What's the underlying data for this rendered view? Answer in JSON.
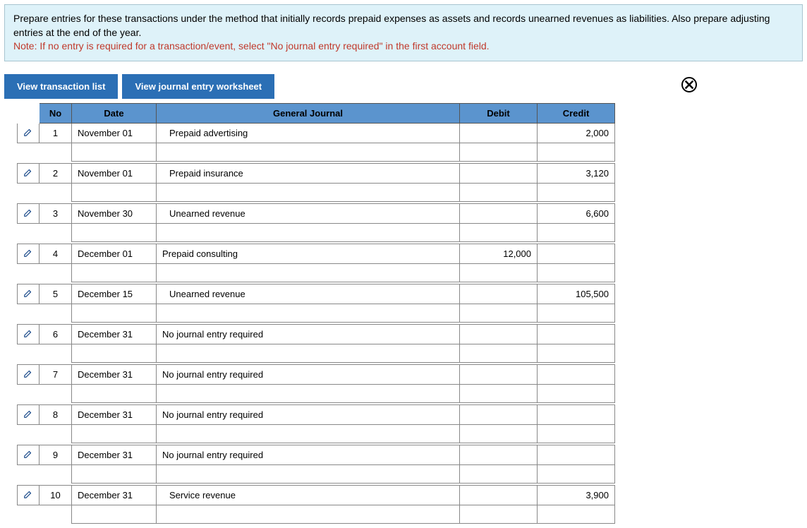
{
  "instructions": {
    "line1": "Prepare entries for these transactions under the method that initially records prepaid expenses as assets and records unearned revenues as liabilities. Also prepare adjusting entries at the end of the year.",
    "note_label": "Note:",
    "note_text": "If no entry is required for a transaction/event, select \"No journal entry required\" in the first account field."
  },
  "tabs": {
    "transaction_list": "View transaction list",
    "journal_worksheet": "View journal entry worksheet"
  },
  "headers": {
    "no": "No",
    "date": "Date",
    "gj": "General Journal",
    "debit": "Debit",
    "credit": "Credit"
  },
  "entries": [
    {
      "no": "1",
      "date": "November 01",
      "account": "Prepaid advertising",
      "indent": 1,
      "debit": "",
      "credit": "2,000"
    },
    {
      "no": "2",
      "date": "November 01",
      "account": "Prepaid insurance",
      "indent": 1,
      "debit": "",
      "credit": "3,120"
    },
    {
      "no": "3",
      "date": "November 30",
      "account": "Unearned revenue",
      "indent": 1,
      "debit": "",
      "credit": "6,600"
    },
    {
      "no": "4",
      "date": "December 01",
      "account": "Prepaid consulting",
      "indent": 0,
      "debit": "12,000",
      "credit": ""
    },
    {
      "no": "5",
      "date": "December 15",
      "account": "Unearned revenue",
      "indent": 1,
      "debit": "",
      "credit": "105,500"
    },
    {
      "no": "6",
      "date": "December 31",
      "account": "No journal entry required",
      "indent": 0,
      "debit": "",
      "credit": ""
    },
    {
      "no": "7",
      "date": "December 31",
      "account": "No journal entry required",
      "indent": 0,
      "debit": "",
      "credit": ""
    },
    {
      "no": "8",
      "date": "December 31",
      "account": "No journal entry required",
      "indent": 0,
      "debit": "",
      "credit": ""
    },
    {
      "no": "9",
      "date": "December 31",
      "account": "No journal entry required",
      "indent": 0,
      "debit": "",
      "credit": ""
    },
    {
      "no": "10",
      "date": "December 31",
      "account": "Service revenue",
      "indent": 1,
      "debit": "",
      "credit": "3,900"
    }
  ]
}
